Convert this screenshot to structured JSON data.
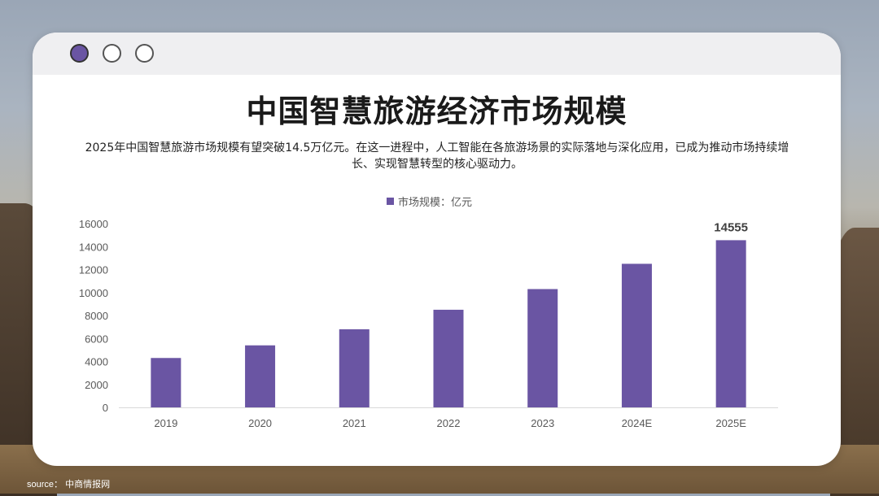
{
  "slide": {
    "title": "中国智慧旅游经济市场规模",
    "description": "2025年中国智慧旅游市场规模有望突破14.5万亿元。在这一进程中，人工智能在各旅游场景的实际落地与深化应用，已成为推动市场持续增长、实现智慧转型的核心驱动力。",
    "source_label": "source：",
    "source_name": "中商情报网"
  },
  "colors": {
    "bar": "#6a55a3",
    "axis_text": "#595959",
    "baseline": "#d9d9d9"
  },
  "chart_data": {
    "type": "bar",
    "categories": [
      "2019",
      "2020",
      "2021",
      "2022",
      "2023",
      "2024E",
      "2025E"
    ],
    "series": [
      {
        "name": "市场规模：亿元",
        "values": [
          4300,
          5400,
          6800,
          8500,
          10300,
          12500,
          14555
        ]
      }
    ],
    "ylim": [
      0,
      16000
    ],
    "yticks": [
      0,
      2000,
      4000,
      6000,
      8000,
      10000,
      12000,
      14000,
      16000
    ],
    "data_labels": [
      {
        "category": "2025E",
        "text": "14555"
      }
    ],
    "legend_position": "top-center",
    "grid": false
  }
}
